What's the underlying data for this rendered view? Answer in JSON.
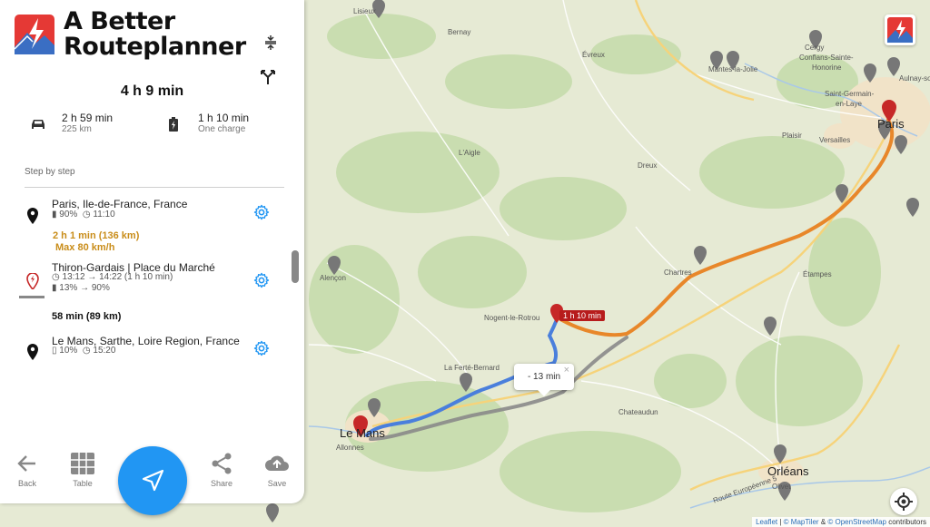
{
  "app": {
    "brand_line1": "A Better",
    "brand_line2": "Routeplanner"
  },
  "summary": {
    "total_time": "4 h 9 min",
    "drive_time": "2 h 59 min",
    "drive_distance": "225 km",
    "charge_time": "1 h 10 min",
    "charge_count": "One charge"
  },
  "steps": {
    "section_label": "Step by step",
    "start": {
      "title": "Paris, Ile-de-France, France",
      "soc": "90%",
      "time": "11:10"
    },
    "leg1": {
      "duration": "2 h 1 min (136 km)",
      "speed": "Max 80 km/h"
    },
    "charger": {
      "title": "Thiron-Gardais | Place du Marché",
      "time_in": "13:12",
      "time_out": "14:22",
      "charge_duration": "(1 h 10 min)",
      "soc_in": "13%",
      "soc_out": "90%"
    },
    "leg2": {
      "duration": "58 min (89 km)"
    },
    "destination": {
      "title": "Le Mans, Sarthe, Loire Region, France",
      "soc": "10%",
      "time": "15:20"
    }
  },
  "nav": {
    "back": "Back",
    "table": "Table",
    "share": "Share",
    "save": "Save"
  },
  "map": {
    "popup_text": "- 13 min",
    "popup_close": "×",
    "charge_label": "1 h 10 min",
    "attribution_leaflet": "Leaflet",
    "attribution_maptiler": "© MapTiler",
    "attribution_osm": "© OpenStreetMap",
    "attribution_suffix": "contributors",
    "towns": {
      "lisieux": "Lisieux",
      "bernay": "Bernay",
      "evreux": "Évreux",
      "cergy": "Cergy",
      "conflans": "Conflans-Sainte-",
      "honorine": "Honorine",
      "aulnay": "Aulnay-so",
      "mantes": "Mantes-la-Jolie",
      "saint_germain": "Saint-Germain-",
      "en_laye": "en-Laye",
      "paris": "Paris",
      "plaisir": "Plaisir",
      "versailles": "Versailles",
      "laigle": "L'Aigle",
      "dreux": "Dreux",
      "chartres": "Chartres",
      "etampes": "Étampes",
      "alencon": "Alençon",
      "nogent": "Nogent-le-Rotrou",
      "laferte": "La Ferté-Bernard",
      "chateaudun": "Chateaudun",
      "lemans": "Le Mans",
      "allonnes": "Allonnes",
      "orleans": "Orléans",
      "olivet": "Olivet",
      "route": "Route Européenne 5"
    }
  },
  "colors": {
    "route_orange": "#e8872a",
    "route_blue": "#4a7fdc",
    "route_alt": "#8a8a8a",
    "accent_blue": "#2196f3",
    "charge_red": "#b71c1c",
    "leg_orange_text": "#c98d1a"
  }
}
